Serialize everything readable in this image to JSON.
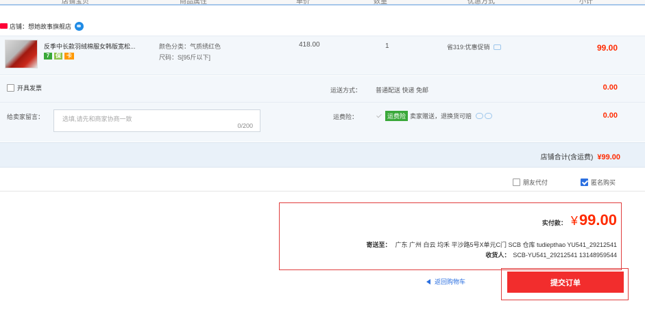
{
  "header_columns": [
    "店铺宝贝",
    "商品属性",
    "单价",
    "数量",
    "优惠方式",
    "小计"
  ],
  "shop": {
    "name": "店铺：想她故事旗舰店"
  },
  "item": {
    "title": "反季中长款羽绒棉服女韩版宽松...",
    "sku_color": "颜色分类：气质绣红色",
    "sku_size": "尺码：S[95斤以下]",
    "price": "418.00",
    "quantity": "1",
    "promo": "省319:优惠促销",
    "subtotal": "99.00",
    "service_icons": [
      "7",
      "保",
      "卡"
    ]
  },
  "invoice_label": "开具发票",
  "shipping": {
    "label": "运送方式：",
    "value": "普通配送 快递 免邮",
    "fee": "0.00"
  },
  "message": {
    "label": "给卖家留言：",
    "placeholder": "选填,请先和商家协商一致",
    "count": "0/200"
  },
  "insurance": {
    "label": "运费险：",
    "badge": "运费险",
    "text": "卖家赠送，退换货可赔",
    "fee": "0.00"
  },
  "shop_total": {
    "label": "店铺合计(含运费)",
    "value": "¥99.00"
  },
  "pay_options": {
    "friend_pay": "朋友代付",
    "anonymous": "匿名购买"
  },
  "summary": {
    "actual_label": "实付款：",
    "currency": "¥",
    "amount": "99.00",
    "address_label": "寄送至：",
    "address": "广东 广州 白云 均禾 平沙路5号X单元C门 SCB 仓库 tudiepthao YU541_29212541",
    "receiver_label": "收货人：",
    "receiver": "SCB-YU541_29212541 13148959544"
  },
  "back_to_cart": "返回购物车",
  "submit_label": "提交订单",
  "colors": {
    "accent_red": "#ff2a00",
    "button_red": "#f22d2d",
    "link_blue": "#2b6fe0"
  }
}
